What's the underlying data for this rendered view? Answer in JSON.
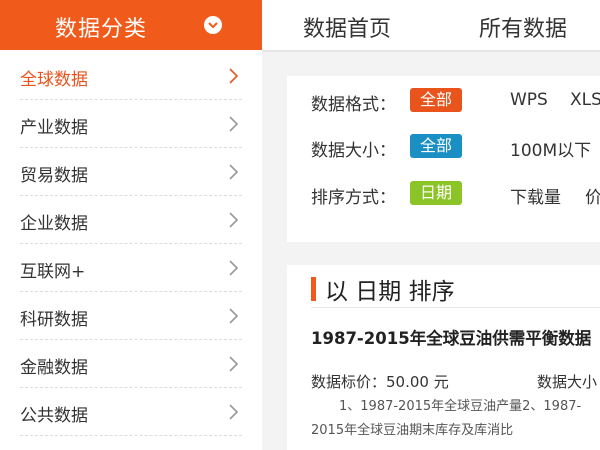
{
  "sidebar": {
    "header": "数据分类",
    "items": [
      {
        "label": "全球数据"
      },
      {
        "label": "产业数据"
      },
      {
        "label": "贸易数据"
      },
      {
        "label": "企业数据"
      },
      {
        "label": "互联网+"
      },
      {
        "label": "科研数据"
      },
      {
        "label": "金融数据"
      },
      {
        "label": "公共数据"
      }
    ]
  },
  "nav": {
    "links": [
      "数据首页",
      "所有数据"
    ]
  },
  "filters": {
    "format": {
      "label": "数据格式：",
      "active": "全部",
      "options": [
        "WPS",
        "XLS"
      ]
    },
    "size": {
      "label": "数据大小：",
      "active": "全部",
      "options": [
        "100M以下"
      ]
    },
    "sort": {
      "label": "排序方式：",
      "active": "日期",
      "options": [
        "下载量",
        "价格"
      ]
    }
  },
  "results": {
    "sort_heading": "以 日期 排序",
    "item": {
      "title": "1987-2015年全球豆油供需平衡数据",
      "price": "数据标价：50.00 元",
      "size_label": "数据大小",
      "description": "1、1987-2015年全球豆油产量2、1987-2015年全球豆油期末库存及库消比"
    }
  },
  "colors": {
    "brand": "#f05a1b",
    "tag_format": "#e8541c",
    "tag_size": "#1a8fc4",
    "tag_sort": "#8bc426"
  }
}
